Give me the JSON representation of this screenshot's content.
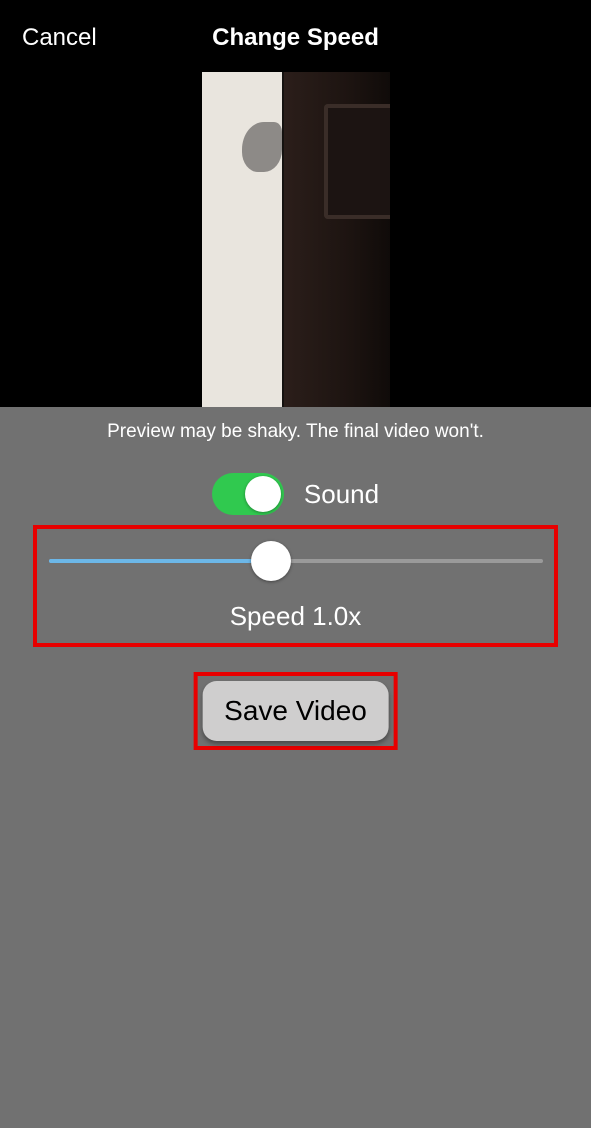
{
  "header": {
    "cancel_label": "Cancel",
    "title": "Change Speed"
  },
  "preview_note": "Preview may be shaky. The final video won't.",
  "sound": {
    "label": "Sound",
    "enabled": true
  },
  "speed": {
    "value": 1.0,
    "label": "Speed 1.0x"
  },
  "save_button_label": "Save Video"
}
